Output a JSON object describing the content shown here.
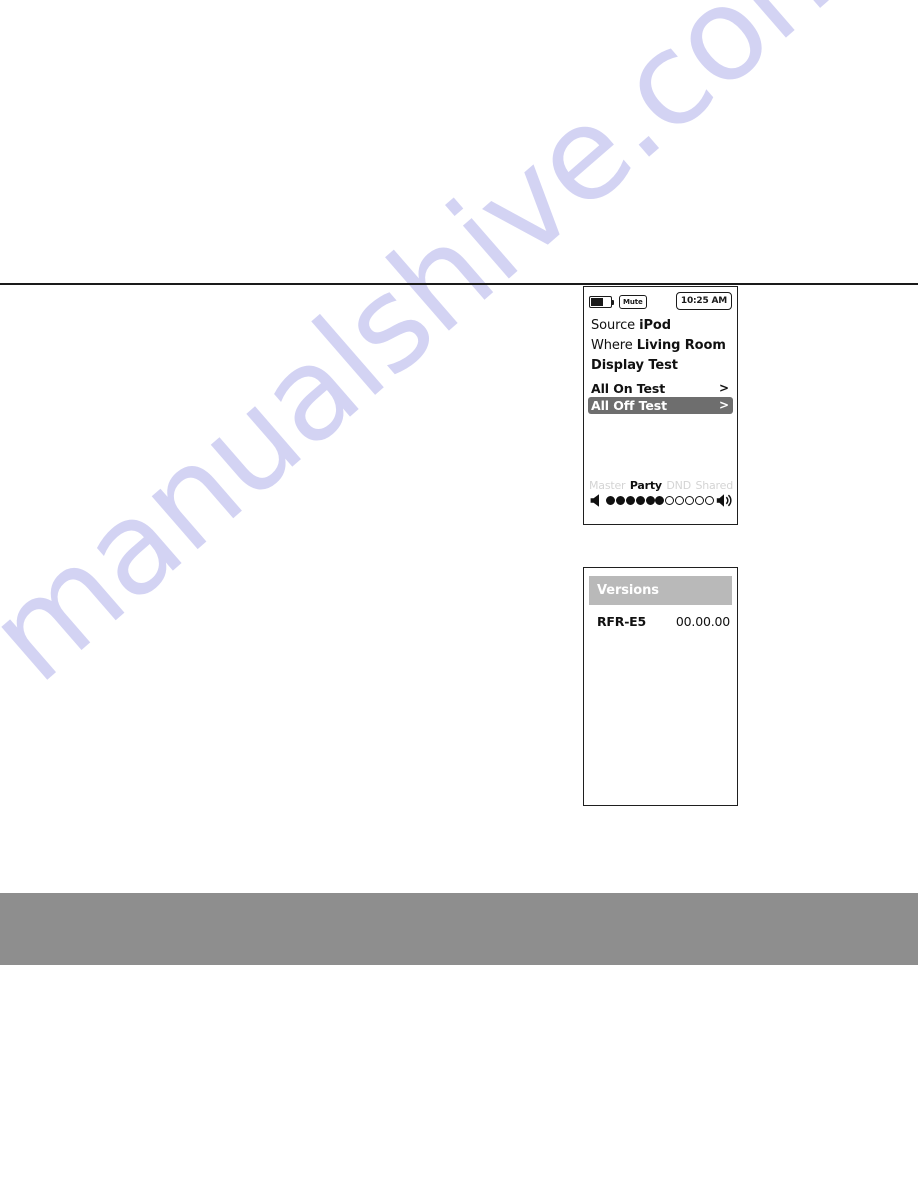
{
  "page": {
    "background_color": "#ffffff",
    "rule_color": "#1a1a1a",
    "footer_band_color": "#8e8e8e"
  },
  "watermark": {
    "text": "manualshive.com",
    "color": "#ccccf2"
  },
  "device_screen": {
    "status_bar": {
      "battery_icon": "battery-icon",
      "mute_label": "Mute",
      "time": "10:25 AM"
    },
    "info_rows": [
      {
        "label": "Source",
        "value": "iPod"
      },
      {
        "label": "Where",
        "value": "Living Room"
      },
      {
        "label": "Display Test",
        "value": ""
      }
    ],
    "menu_items": [
      {
        "label": "All On Test",
        "chevron": ">",
        "selected": false
      },
      {
        "label": "All Off Test",
        "chevron": ">",
        "selected": true
      }
    ],
    "modes": [
      {
        "label": "Master",
        "active": false
      },
      {
        "label": "Party",
        "active": true
      },
      {
        "label": "DND",
        "active": false
      },
      {
        "label": "Shared",
        "active": false
      }
    ],
    "volume": {
      "left_icon": "speaker-low-icon",
      "right_icon": "speaker-high-icon",
      "filled": 6,
      "total": 11
    },
    "highlight_color": "#6e6e6e"
  },
  "versions_screen": {
    "header": "Versions",
    "header_color": "#b9b9b9",
    "rows": [
      {
        "name": "RFR-E5",
        "version": "00.00.00"
      }
    ]
  }
}
